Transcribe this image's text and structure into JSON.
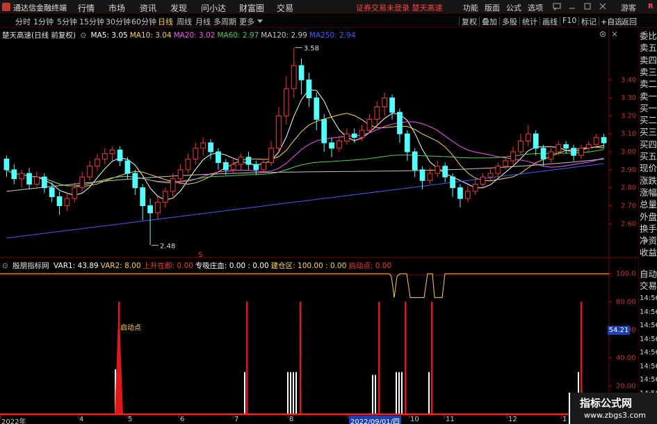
{
  "menubar": {
    "app_title": "通达信金融终端",
    "items": [
      "行情",
      "市场",
      "资讯",
      "发现",
      "问小达",
      "财富圈",
      "交易"
    ],
    "notice": "证券交易未登录 楚天高速",
    "right_items": [
      "功能",
      "版面",
      "公式",
      "选项"
    ],
    "guest": "游客",
    "badge": "R"
  },
  "periodbar": {
    "periods": [
      "分时",
      "1分钟",
      "5分钟",
      "15分钟",
      "30分钟",
      "60分钟",
      "日线",
      "周线",
      "月线",
      "多周期",
      "更多"
    ],
    "active_period": "日线",
    "tools": [
      "复权",
      "叠加",
      "多股",
      "统计",
      "画线",
      "F10",
      "标记",
      "+自选",
      "返回"
    ]
  },
  "legend_main": {
    "stock": "楚天高速(日线 前复权)",
    "ma": [
      {
        "label": "MA5: 3.05",
        "color": "#ffffff"
      },
      {
        "label": "MA10: 3.04",
        "color": "#ffd34f"
      },
      {
        "label": "MA20: 3.02",
        "color": "#ff4fff"
      },
      {
        "label": "MA60: 2.97",
        "color": "#4fd34f"
      },
      {
        "label": "MA120: 2.99",
        "color": "#c8c8c8"
      },
      {
        "label": "MA250: 2.94",
        "color": "#3f5fff"
      }
    ]
  },
  "legend_sub": {
    "name": "殷朋指标网",
    "items": [
      {
        "label": "VAR1: 43.89",
        "color": "#ffffff"
      },
      {
        "label": "VAR2: 8.00",
        "color": "#ffd34f"
      },
      {
        "label": "上升在即: 0.00",
        "color": "#ff3030"
      },
      {
        "label": "专吸庄血: 0.00 : 0.00",
        "color": "#ffffff"
      },
      {
        "label": "建仓区: 100.00 : 0.00",
        "color": "#ffd34f"
      },
      {
        "label": "启动点: 0.00",
        "color": "#ff3030"
      }
    ]
  },
  "main_axis": [
    "3.40",
    "3.30",
    "3.20",
    "3.10",
    "3.00",
    "2.90",
    "2.80",
    "2.70",
    "2.60"
  ],
  "sub_axis": [
    "100.0",
    "80.00",
    "60.00",
    "40.00",
    "20.00"
  ],
  "annotations": {
    "high": "3.58",
    "low": "2.48",
    "signal": "启动点",
    "price_badge": "54.21"
  },
  "side_panel": {
    "items": [
      "委比",
      "卖五",
      "卖四",
      "卖三",
      "卖二",
      "卖一",
      "买一",
      "买二",
      "买三",
      "买四",
      "买五",
      "现价",
      "涨跌",
      "涨幅",
      "总量",
      "外盘",
      "换手",
      "净资",
      "收益"
    ],
    "sub_items": [
      "自动",
      "交易"
    ],
    "times": [
      "14:56",
      "14:56",
      "14:56",
      "14:56",
      "14:56",
      "14:56",
      "14:56",
      "14:56",
      "14:56"
    ]
  },
  "date_axis": {
    "ticks": [
      "2022年",
      "4",
      "5",
      "6",
      "7",
      "8",
      "2022/09/01/四",
      "10",
      "11",
      "12",
      "1"
    ],
    "highlight": "2022/09/01/四"
  },
  "watermark": {
    "title": "指标公式网",
    "url": "www.zbgs3.com"
  },
  "chart_data": {
    "type": "candlestick",
    "ylim": [
      2.45,
      3.62
    ],
    "candles": [
      [
        2.96,
        2.9,
        2.98,
        2.86
      ],
      [
        2.9,
        2.85,
        2.93,
        2.82
      ],
      [
        2.85,
        2.88,
        2.9,
        2.8
      ],
      [
        2.88,
        2.82,
        2.91,
        2.79
      ],
      [
        2.82,
        2.86,
        2.89,
        2.8
      ],
      [
        2.86,
        2.8,
        2.88,
        2.77
      ],
      [
        2.8,
        2.75,
        2.83,
        2.72
      ],
      [
        2.75,
        2.7,
        2.78,
        2.65
      ],
      [
        2.7,
        2.74,
        2.77,
        2.67
      ],
      [
        2.74,
        2.8,
        2.83,
        2.72
      ],
      [
        2.8,
        2.86,
        2.89,
        2.78
      ],
      [
        2.86,
        2.92,
        2.95,
        2.84
      ],
      [
        2.92,
        2.96,
        2.99,
        2.89
      ],
      [
        2.96,
        2.99,
        3.02,
        2.93
      ],
      [
        2.99,
        3.01,
        3.03,
        2.95
      ],
      [
        3.01,
        2.95,
        3.03,
        2.92
      ],
      [
        2.95,
        2.88,
        2.97,
        2.85
      ],
      [
        2.88,
        2.8,
        2.9,
        2.76
      ],
      [
        2.8,
        2.7,
        2.82,
        2.62
      ],
      [
        2.7,
        2.66,
        2.74,
        2.48
      ],
      [
        2.66,
        2.72,
        2.75,
        2.62
      ],
      [
        2.72,
        2.78,
        2.8,
        2.69
      ],
      [
        2.78,
        2.85,
        2.88,
        2.75
      ],
      [
        2.85,
        2.9,
        2.93,
        2.82
      ],
      [
        2.9,
        2.96,
        2.99,
        2.88
      ],
      [
        2.96,
        3.02,
        3.05,
        2.93
      ],
      [
        3.02,
        3.05,
        3.08,
        2.98
      ],
      [
        3.05,
        3.0,
        3.07,
        2.96
      ],
      [
        3.0,
        2.94,
        3.02,
        2.9
      ],
      [
        2.94,
        2.9,
        2.96,
        2.87
      ],
      [
        2.9,
        2.93,
        2.96,
        2.88
      ],
      [
        2.93,
        2.97,
        2.99,
        2.9
      ],
      [
        2.97,
        2.93,
        3.0,
        2.9
      ],
      [
        2.93,
        2.9,
        2.95,
        2.87
      ],
      [
        2.9,
        2.94,
        2.96,
        2.88
      ],
      [
        2.94,
        3.02,
        3.06,
        2.92
      ],
      [
        3.02,
        3.2,
        3.25,
        3.0
      ],
      [
        3.2,
        3.35,
        3.42,
        3.15
      ],
      [
        3.35,
        3.48,
        3.58,
        3.3
      ],
      [
        3.48,
        3.4,
        3.52,
        3.32
      ],
      [
        3.4,
        3.3,
        3.44,
        3.25
      ],
      [
        3.3,
        3.18,
        3.33,
        3.12
      ],
      [
        3.18,
        3.05,
        3.21,
        3.0
      ],
      [
        3.05,
        3.02,
        3.08,
        2.97
      ],
      [
        3.02,
        3.06,
        3.09,
        3.0
      ],
      [
        3.06,
        3.1,
        3.13,
        3.04
      ],
      [
        3.1,
        3.08,
        3.13,
        3.05
      ],
      [
        3.08,
        3.12,
        3.15,
        3.06
      ],
      [
        3.12,
        3.18,
        3.21,
        3.1
      ],
      [
        3.18,
        3.25,
        3.28,
        3.15
      ],
      [
        3.25,
        3.3,
        3.33,
        3.2
      ],
      [
        3.3,
        3.22,
        3.32,
        3.18
      ],
      [
        3.22,
        3.1,
        3.24,
        3.05
      ],
      [
        3.1,
        3.0,
        3.12,
        2.95
      ],
      [
        3.0,
        2.9,
        3.02,
        2.86
      ],
      [
        2.9,
        2.84,
        2.92,
        2.79
      ],
      [
        2.84,
        2.88,
        2.91,
        2.82
      ],
      [
        2.88,
        2.92,
        2.95,
        2.86
      ],
      [
        2.92,
        2.86,
        2.94,
        2.83
      ],
      [
        2.86,
        2.8,
        2.88,
        2.75
      ],
      [
        2.8,
        2.74,
        2.82,
        2.69
      ],
      [
        2.74,
        2.78,
        2.81,
        2.72
      ],
      [
        2.78,
        2.82,
        2.85,
        2.76
      ],
      [
        2.82,
        2.86,
        2.88,
        2.8
      ],
      [
        2.86,
        2.88,
        2.91,
        2.84
      ],
      [
        2.88,
        2.92,
        2.94,
        2.86
      ],
      [
        2.92,
        2.95,
        2.97,
        2.9
      ],
      [
        2.95,
        3.0,
        3.03,
        2.93
      ],
      [
        3.0,
        3.06,
        3.1,
        2.98
      ],
      [
        3.06,
        3.1,
        3.15,
        3.03
      ],
      [
        3.1,
        3.02,
        3.12,
        2.98
      ],
      [
        3.02,
        2.96,
        3.04,
        2.92
      ],
      [
        2.96,
        3.0,
        3.02,
        2.94
      ],
      [
        3.0,
        3.04,
        3.06,
        2.98
      ],
      [
        3.04,
        3.02,
        3.06,
        2.99
      ],
      [
        3.02,
        2.98,
        3.04,
        2.95
      ],
      [
        2.98,
        3.02,
        3.04,
        2.96
      ],
      [
        3.02,
        3.04,
        3.06,
        3.0
      ],
      [
        3.04,
        3.08,
        3.1,
        3.02
      ],
      [
        3.08,
        3.05,
        3.1,
        3.02
      ]
    ],
    "ma_lines": [
      {
        "name": "MA5",
        "color": "#ffffff"
      },
      {
        "name": "MA10",
        "color": "#ffd34f"
      },
      {
        "name": "MA20",
        "color": "#ff4fff"
      },
      {
        "name": "MA60",
        "color": "#4fd34f"
      },
      {
        "name": "MA120",
        "color": "#c8c8c8"
      },
      {
        "name": "MA250",
        "color": "#3f5fff"
      }
    ],
    "sub_ylim": [
      0,
      105
    ],
    "red_bars": [
      {
        "x": 171,
        "v": 80
      },
      {
        "x": 355,
        "v": 80
      },
      {
        "x": 432,
        "v": 80
      },
      {
        "x": 545,
        "v": 80
      },
      {
        "x": 583,
        "v": 80
      },
      {
        "x": 621,
        "v": 80
      },
      {
        "x": 836,
        "v": 80
      }
    ],
    "white_bars": [
      {
        "x": 166,
        "v": 32
      },
      {
        "x": 352,
        "v": 30
      },
      {
        "x": 414,
        "v": 30
      },
      {
        "x": 418,
        "v": 30
      },
      {
        "x": 422,
        "v": 30
      },
      {
        "x": 426,
        "v": 30
      },
      {
        "x": 536,
        "v": 28
      },
      {
        "x": 540,
        "v": 28
      },
      {
        "x": 570,
        "v": 30
      },
      {
        "x": 574,
        "v": 30
      },
      {
        "x": 578,
        "v": 30
      },
      {
        "x": 617,
        "v": 30
      },
      {
        "x": 832,
        "v": 30
      }
    ],
    "yellow_line": {
      "name": "建仓区",
      "color": "#ffd34f"
    }
  }
}
